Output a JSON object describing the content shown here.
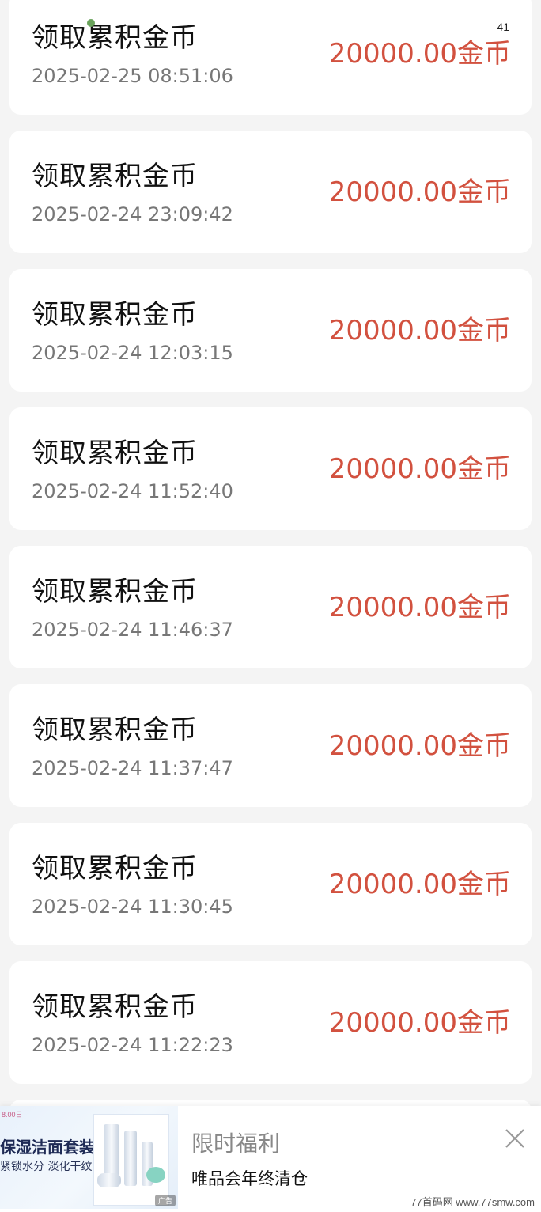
{
  "status_bar": {
    "indicator": "41"
  },
  "records": [
    {
      "title": "领取累积金币",
      "time": "2025-02-25 08:51:06",
      "amount": "20000.00金币"
    },
    {
      "title": "领取累积金币",
      "time": "2025-02-24 23:09:42",
      "amount": "20000.00金币"
    },
    {
      "title": "领取累积金币",
      "time": "2025-02-24 12:03:15",
      "amount": "20000.00金币"
    },
    {
      "title": "领取累积金币",
      "time": "2025-02-24 11:52:40",
      "amount": "20000.00金币"
    },
    {
      "title": "领取累积金币",
      "time": "2025-02-24 11:46:37",
      "amount": "20000.00金币"
    },
    {
      "title": "领取累积金币",
      "time": "2025-02-24 11:37:47",
      "amount": "20000.00金币"
    },
    {
      "title": "领取累积金币",
      "time": "2025-02-24 11:30:45",
      "amount": "20000.00金币"
    },
    {
      "title": "领取累积金币",
      "time": "2025-02-24 11:22:23",
      "amount": "20000.00金币"
    }
  ],
  "colors": {
    "amount": "#d2513f",
    "background": "#f4f4f4"
  },
  "ad": {
    "image_headline": "保湿洁面套装",
    "image_subline": "紧锁水分 淡化干纹",
    "image_brand": "8.00日",
    "image_badge": "广告",
    "title": "限时福利",
    "description": "唯品会年终清仓",
    "close_icon": "close-icon"
  },
  "watermark": "77首码网 www.77smw.com"
}
